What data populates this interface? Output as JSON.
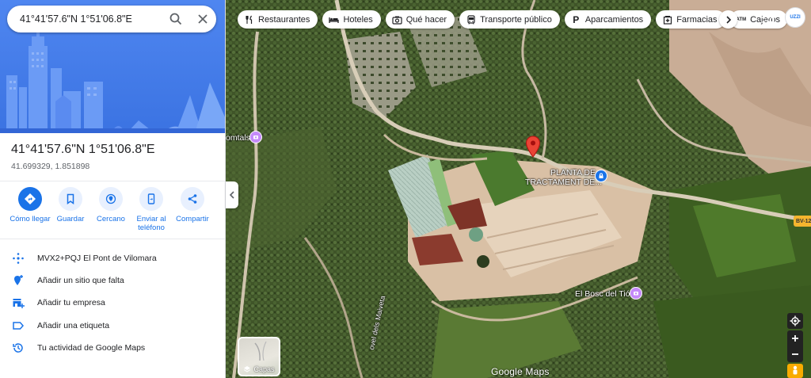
{
  "search": {
    "query": "41°41'57.6\"N 1°51'06.8\"E"
  },
  "place": {
    "title": "41°41'57.6\"N 1°51'06.8\"E",
    "decimal_coords": "41.699329, 1.851898"
  },
  "actions": [
    {
      "label": "Cómo llegar",
      "icon": "directions-icon"
    },
    {
      "label": "Guardar",
      "icon": "bookmark-icon"
    },
    {
      "label": "Cercano",
      "icon": "nearby-icon"
    },
    {
      "label": "Enviar al teléfono",
      "icon": "send-to-phone-icon"
    },
    {
      "label": "Compartir",
      "icon": "share-icon"
    }
  ],
  "info_rows": [
    {
      "text": "MVX2+PQJ El Pont de Vilomara",
      "icon": "plus-code-icon"
    },
    {
      "text": "Añadir un sitio que falta",
      "icon": "add-place-icon"
    },
    {
      "text": "Añadir tu empresa",
      "icon": "add-business-icon"
    },
    {
      "text": "Añadir una etiqueta",
      "icon": "label-icon"
    },
    {
      "text": "Tu actividad de Google Maps",
      "icon": "history-icon"
    }
  ],
  "chips": [
    {
      "label": "Restaurantes",
      "icon": "restaurant-icon"
    },
    {
      "label": "Hoteles",
      "icon": "hotel-icon"
    },
    {
      "label": "Qué hacer",
      "icon": "camera-icon"
    },
    {
      "label": "Transporte público",
      "icon": "transit-icon"
    },
    {
      "label": "Aparcamientos",
      "icon": "parking-icon"
    },
    {
      "label": "Farmacias",
      "icon": "pharmacy-icon"
    },
    {
      "label": "Cajeros",
      "icon": "atm-icon"
    }
  ],
  "map": {
    "labels": {
      "plant_line1": "PLANTA DE",
      "plant_line2": "TRACTAMENT DE...",
      "bosc": "El Bosc del Tió",
      "comtals": "omtals",
      "road_vertical": "ovel dels Maiveta",
      "road_shield": "BV-12"
    },
    "layers_label": "Capas",
    "logo": "Google Maps",
    "avatar_text": "UZZI"
  },
  "colors": {
    "accent": "#1a73e8",
    "hero": "#4a7fec",
    "pin": "#ea4335",
    "poi": "#c58af9"
  }
}
